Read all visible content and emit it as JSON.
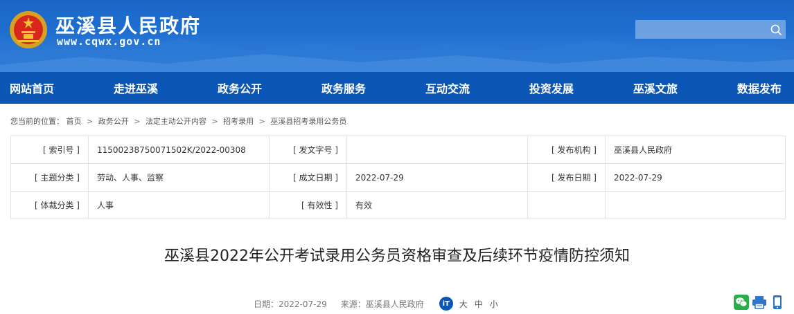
{
  "site": {
    "title": "巫溪县人民政府",
    "url": "www.cqwx.gov.cn",
    "search_placeholder": ""
  },
  "nav": [
    "网站首页",
    "走进巫溪",
    "政务公开",
    "政务服务",
    "互动交流",
    "投资发展",
    "巫溪文旅",
    "数据发布"
  ],
  "breadcrumb": {
    "prefix": "您当前的位置：",
    "items": [
      "首页",
      "政务公开",
      "法定主动公开内容",
      "招考录用",
      "巫溪县招考录用公务员"
    ]
  },
  "meta": {
    "index_label": "[ 索引号 ]",
    "index_value": "11500238750071502K/2022-00308",
    "doc_no_label": "[ 发文字号 ]",
    "doc_no_value": "",
    "org_label": "[ 发布机构 ]",
    "org_value": "巫溪县人民政府",
    "topic_label": "[ 主题分类 ]",
    "topic_value": "劳动、人事、监察",
    "created_label": "[ 成文日期 ]",
    "created_value": "2022-07-29",
    "pub_label": "[ 发布日期 ]",
    "pub_value": "2022-07-29",
    "genre_label": "[ 体裁分类 ]",
    "genre_value": "人事",
    "valid_label": "[ 有效性 ]",
    "valid_value": "有效"
  },
  "article": {
    "title": "巫溪县2022年公开考试录用公务员资格审查及后续环节疫情防控须知",
    "date_text": "日期：2022-07-29",
    "source_text": "来源：巫溪县人民政府",
    "font_icon_text": "iT",
    "font_large": "大",
    "font_medium": "中",
    "font_small": "小"
  },
  "colors": {
    "banner": "#1f6fd0",
    "nav": "#0c57b5",
    "wechat": "#2aae4a",
    "print": "#2f74c8"
  },
  "icons": [
    "search-icon",
    "national-emblem-icon",
    "wechat-icon",
    "print-icon",
    "phone-icon"
  ]
}
